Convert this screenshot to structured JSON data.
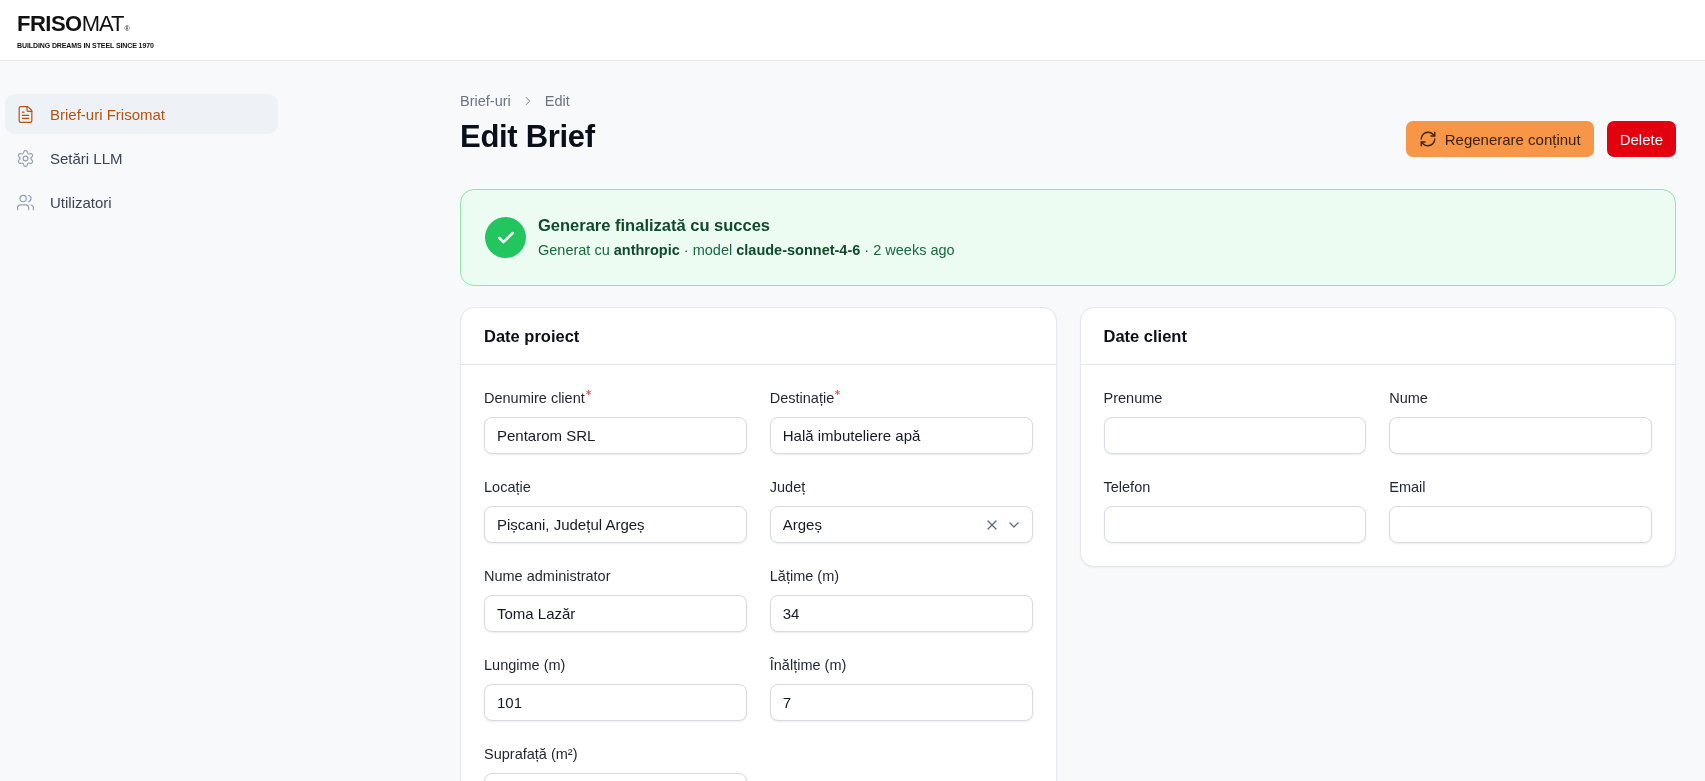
{
  "header": {
    "logo": {
      "wordmark": "**FRISO**MAT$_{®}$",
      "tagline": "BUILDING DREAMS IN STEEL SINCE 1970"
    }
  },
  "sidebar": {
    "items": [
      {
        "label": "Brief-uri Frisomat",
        "selected": true
      },
      {
        "label": "Setări LLM",
        "selected": false
      },
      {
        "label": "Utilizatori",
        "selected": false
      }
    ]
  },
  "breadcrumb": [
    "Brief-uri",
    "Edit"
  ],
  "page": {
    "title": "Edit Brief",
    "actions": [
      {
        "label": "Regenerare conținut",
        "kind": "accent"
      },
      {
        "label": "Delete",
        "kind": "danger"
      }
    ]
  },
  "banner": {
    "kind": "success",
    "title": "Generare finalizată cu succes",
    "text": "Generat cu **anthropic** · model **claude-sonnet-4-6** · 2 weeks ago"
  },
  "cards": [
    {
      "title": "Date proiect",
      "fields": [
        {
          "label": "Denumire client",
          "required": true,
          "kind": "text",
          "value": "Pentarom SRL"
        },
        {
          "label": "Destinație",
          "required": true,
          "kind": "text",
          "value": "Hală imbuteliere apă"
        },
        {
          "label": "Locație",
          "required": false,
          "kind": "text",
          "value": "Pișcani, Județul Argeș"
        },
        {
          "label": "Județ",
          "required": false,
          "kind": "select",
          "value": "Argeș"
        },
        {
          "label": "Nume administrator",
          "required": false,
          "kind": "text",
          "value": "Toma Lazăr"
        },
        {
          "label": "Lățime (m)",
          "required": false,
          "kind": "text",
          "value": "34"
        },
        {
          "label": "Lungime (m)",
          "required": false,
          "kind": "text",
          "value": "101"
        },
        {
          "label": "Înălțime (m)",
          "required": false,
          "kind": "text",
          "value": "7"
        },
        {
          "label": "Suprafață (m²)",
          "required": false,
          "kind": "text"
        }
      ]
    },
    {
      "title": "Date client",
      "fields": [
        {
          "label": "Prenume",
          "required": false,
          "kind": "text"
        },
        {
          "label": "Nume",
          "required": false,
          "kind": "text"
        },
        {
          "label": "Telefon",
          "required": false,
          "kind": "text"
        },
        {
          "label": "Email",
          "required": false,
          "kind": "text"
        }
      ]
    }
  ]
}
